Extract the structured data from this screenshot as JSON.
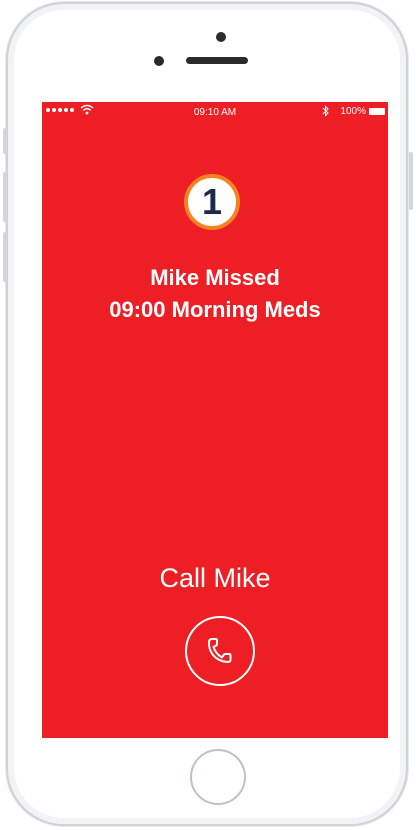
{
  "status_bar": {
    "time": "09:10 AM",
    "battery": "100%"
  },
  "alert": {
    "badge_count": "1",
    "line1": "Mike Missed",
    "line2": "09:00 Morning Meds"
  },
  "call": {
    "label": "Call Mike"
  },
  "icons": {
    "wifi": "wifi-icon",
    "bluetooth": "bluetooth-icon",
    "battery": "battery-icon",
    "phone": "phone-icon"
  },
  "colors": {
    "screen_background": "#ed1f24",
    "badge_border": "#f5821f",
    "badge_text": "#1b2a4a",
    "text": "#ffffff"
  }
}
